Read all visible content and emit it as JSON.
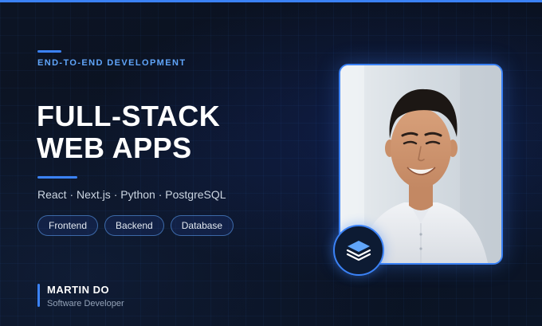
{
  "header": {
    "eyebrow": "END-TO-END DEVELOPMENT",
    "title_lines": [
      "FULL-STACK",
      "WEB APPS"
    ]
  },
  "tech_stack": "React · Next.js · Python · PostgreSQL",
  "tags": [
    "Frontend",
    "Backend",
    "Database"
  ],
  "author": {
    "name": "MARTIN DO",
    "role": "Software Developer"
  },
  "icons": {
    "badge": "layers-icon"
  },
  "colors": {
    "accent": "#3b82f6",
    "accent_light": "#60a5fa",
    "background": "#0b1220"
  }
}
